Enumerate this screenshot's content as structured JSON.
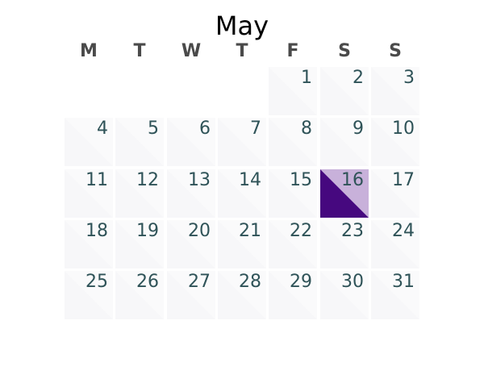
{
  "calendar": {
    "month": "May",
    "weekdays": [
      "M",
      "T",
      "W",
      "T",
      "F",
      "S",
      "S"
    ],
    "first_weekday_index": 4,
    "days_in_month": 31,
    "selected_day": "16",
    "days": [
      "1",
      "2",
      "3",
      "4",
      "5",
      "6",
      "7",
      "8",
      "9",
      "10",
      "11",
      "12",
      "13",
      "14",
      "15",
      "16",
      "17",
      "18",
      "19",
      "20",
      "21",
      "22",
      "23",
      "24",
      "25",
      "26",
      "27",
      "28",
      "29",
      "30",
      "31"
    ]
  },
  "colors": {
    "cell_light": "#f7f7f9",
    "cell_dark": "#fafafb",
    "selected_dark": "#46087f",
    "selected_light": "#c8b1da",
    "day_text": "#2f5358"
  }
}
